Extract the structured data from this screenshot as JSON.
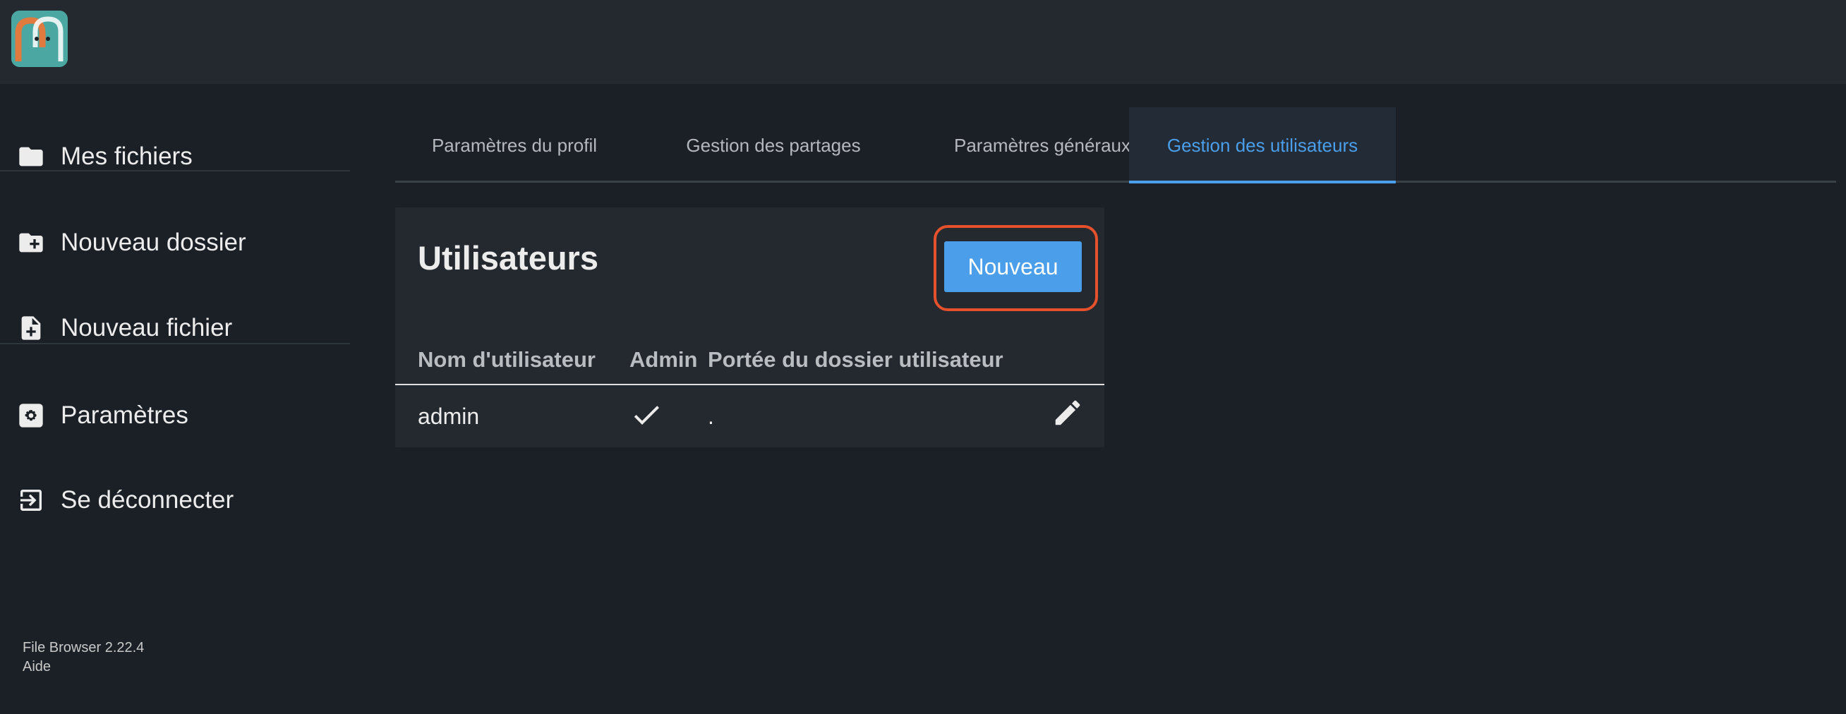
{
  "app": {
    "logo_icon": "filebrowser-logo-icon"
  },
  "sidebar": {
    "items": [
      {
        "label": "Mes fichiers",
        "icon": "folder-icon"
      },
      {
        "label": "Nouveau dossier",
        "icon": "new-folder-icon"
      },
      {
        "label": "Nouveau fichier",
        "icon": "new-file-icon"
      },
      {
        "label": "Paramètres",
        "icon": "settings-icon"
      },
      {
        "label": "Se déconnecter",
        "icon": "logout-icon"
      }
    ],
    "footer": {
      "version": "File Browser 2.22.4",
      "help": "Aide"
    }
  },
  "tabs": [
    {
      "label": "Paramètres du profil",
      "active": false
    },
    {
      "label": "Gestion des partages",
      "active": false
    },
    {
      "label": "Paramètres généraux",
      "active": false
    },
    {
      "label": "Gestion des utilisateurs",
      "active": true
    }
  ],
  "users": {
    "title": "Utilisateurs",
    "new_button": "Nouveau",
    "columns": [
      "Nom d'utilisateur",
      "Admin",
      "Portée du dossier utilisateur"
    ],
    "rows": [
      {
        "username": "admin",
        "admin": true,
        "scope": ".",
        "edit_icon": "edit-icon"
      }
    ]
  },
  "colors": {
    "accent": "#4b9eea",
    "highlight": "#e4512c",
    "background": "#1b2026",
    "panel": "#24292f"
  }
}
